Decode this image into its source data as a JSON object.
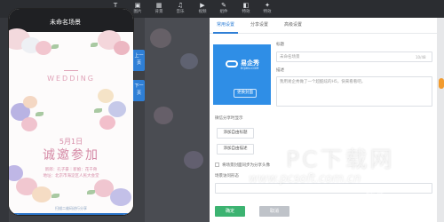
{
  "toolbar": {
    "items": [
      {
        "icon": "T",
        "label": "文本"
      },
      {
        "icon": "▣",
        "label": "图片"
      },
      {
        "icon": "▦",
        "label": "背景"
      },
      {
        "icon": "♫",
        "label": "音乐"
      },
      {
        "icon": "▶",
        "label": "视频"
      },
      {
        "icon": "✎",
        "label": "组件"
      },
      {
        "icon": "◧",
        "label": "特效"
      },
      {
        "icon": "✦",
        "label": "特效"
      }
    ]
  },
  "phone": {
    "title": "未命名场景",
    "wedding": "WEDDING",
    "date": "5月1日",
    "invite": "诚邀参加",
    "line1": "新郎：孔子豪｜新娘：花千骨",
    "line2": "地址：北京市海淀区人民大会堂",
    "footer": "扫描二维码进行分享"
  },
  "pagenav": {
    "up": "上一页",
    "down": "下一页"
  },
  "panel": {
    "tabs": [
      "常用设置",
      "分享设置",
      "高级设置"
    ],
    "cover": {
      "brand": "易企秀",
      "site": "EQXIU.COM",
      "change_button": "更换封面"
    },
    "title_label": "标题",
    "title_value": "未命名场景",
    "title_counter": "10/48",
    "desc_label": "描述",
    "desc_value": "我用易企秀做了一个超酷炫的H5，快来看看吧。",
    "wechat_label": "微信分享时显示",
    "add_title_button": "添加自由标题",
    "add_desc_button": "添加自由描述",
    "checkbox_label": "将场景封面同步为分享头像",
    "visits_label": "场景访问形态",
    "ok_button": "确定",
    "cancel_button": "取消"
  },
  "watermark": {
    "big": "PC下载网",
    "url": "www.pcsoft.com.cn",
    "small": "经验"
  },
  "colors": {
    "accent": "#2f7fd6",
    "cover": "#2f8ee6",
    "ok": "#3cb371",
    "pink": "#d58aa6"
  }
}
